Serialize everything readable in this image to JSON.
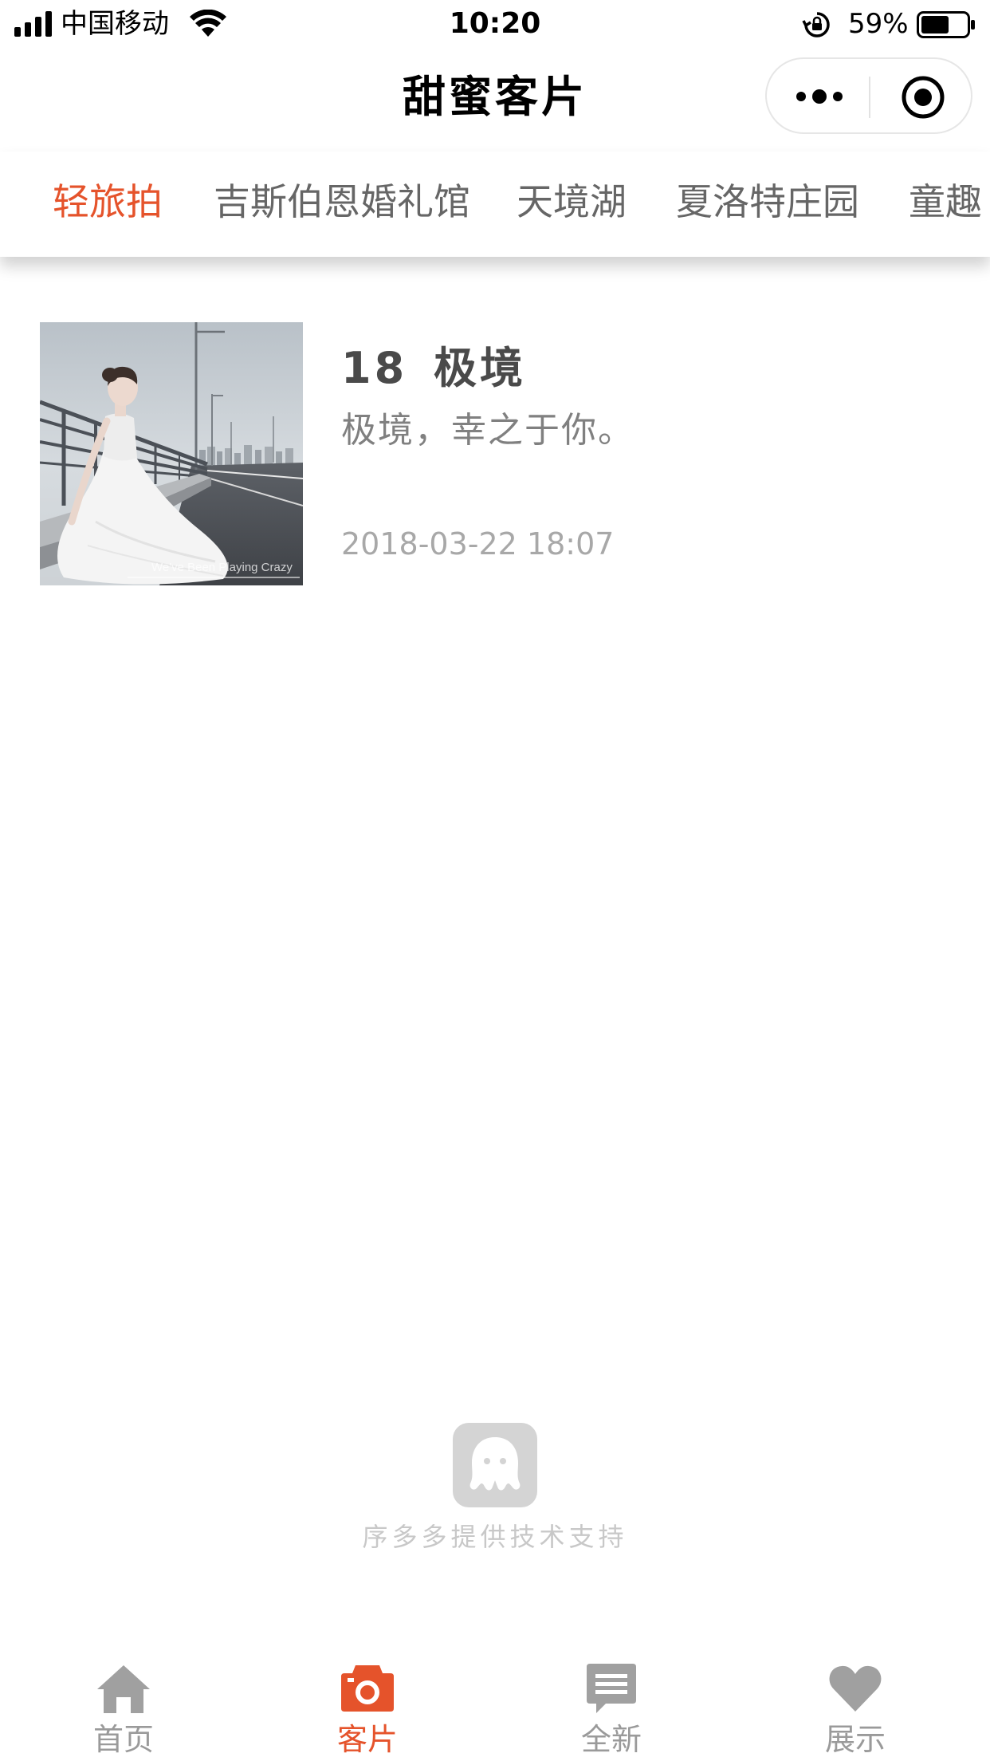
{
  "status_bar": {
    "carrier": "中国移动",
    "time": "10:20",
    "battery": "59%"
  },
  "nav": {
    "title": "甜蜜客片"
  },
  "category_tabs": [
    {
      "label": "轻旅拍",
      "active": true
    },
    {
      "label": "吉斯伯恩婚礼馆",
      "active": false
    },
    {
      "label": "天境湖",
      "active": false
    },
    {
      "label": "夏洛特庄园",
      "active": false
    },
    {
      "label": "童趣",
      "active": false
    }
  ],
  "articles": [
    {
      "title": "18  极境",
      "description": "极境，幸之于你。",
      "time": "2018-03-22 18:07",
      "image_watermark": "We've Been Playing Crazy"
    }
  ],
  "support": {
    "text": "序多多提供技术支持"
  },
  "tabbar": [
    {
      "label": "首页",
      "icon": "home-icon",
      "active": false
    },
    {
      "label": "客片",
      "icon": "camera-icon",
      "active": true
    },
    {
      "label": "全新",
      "icon": "message-icon",
      "active": false
    },
    {
      "label": "展示",
      "icon": "heart-icon",
      "active": false
    }
  ],
  "colors": {
    "accent": "#e5532b",
    "tab_inactive": "#666666",
    "tabbar_inactive": "#9a9a9a",
    "support_text": "#c8c8c8"
  }
}
